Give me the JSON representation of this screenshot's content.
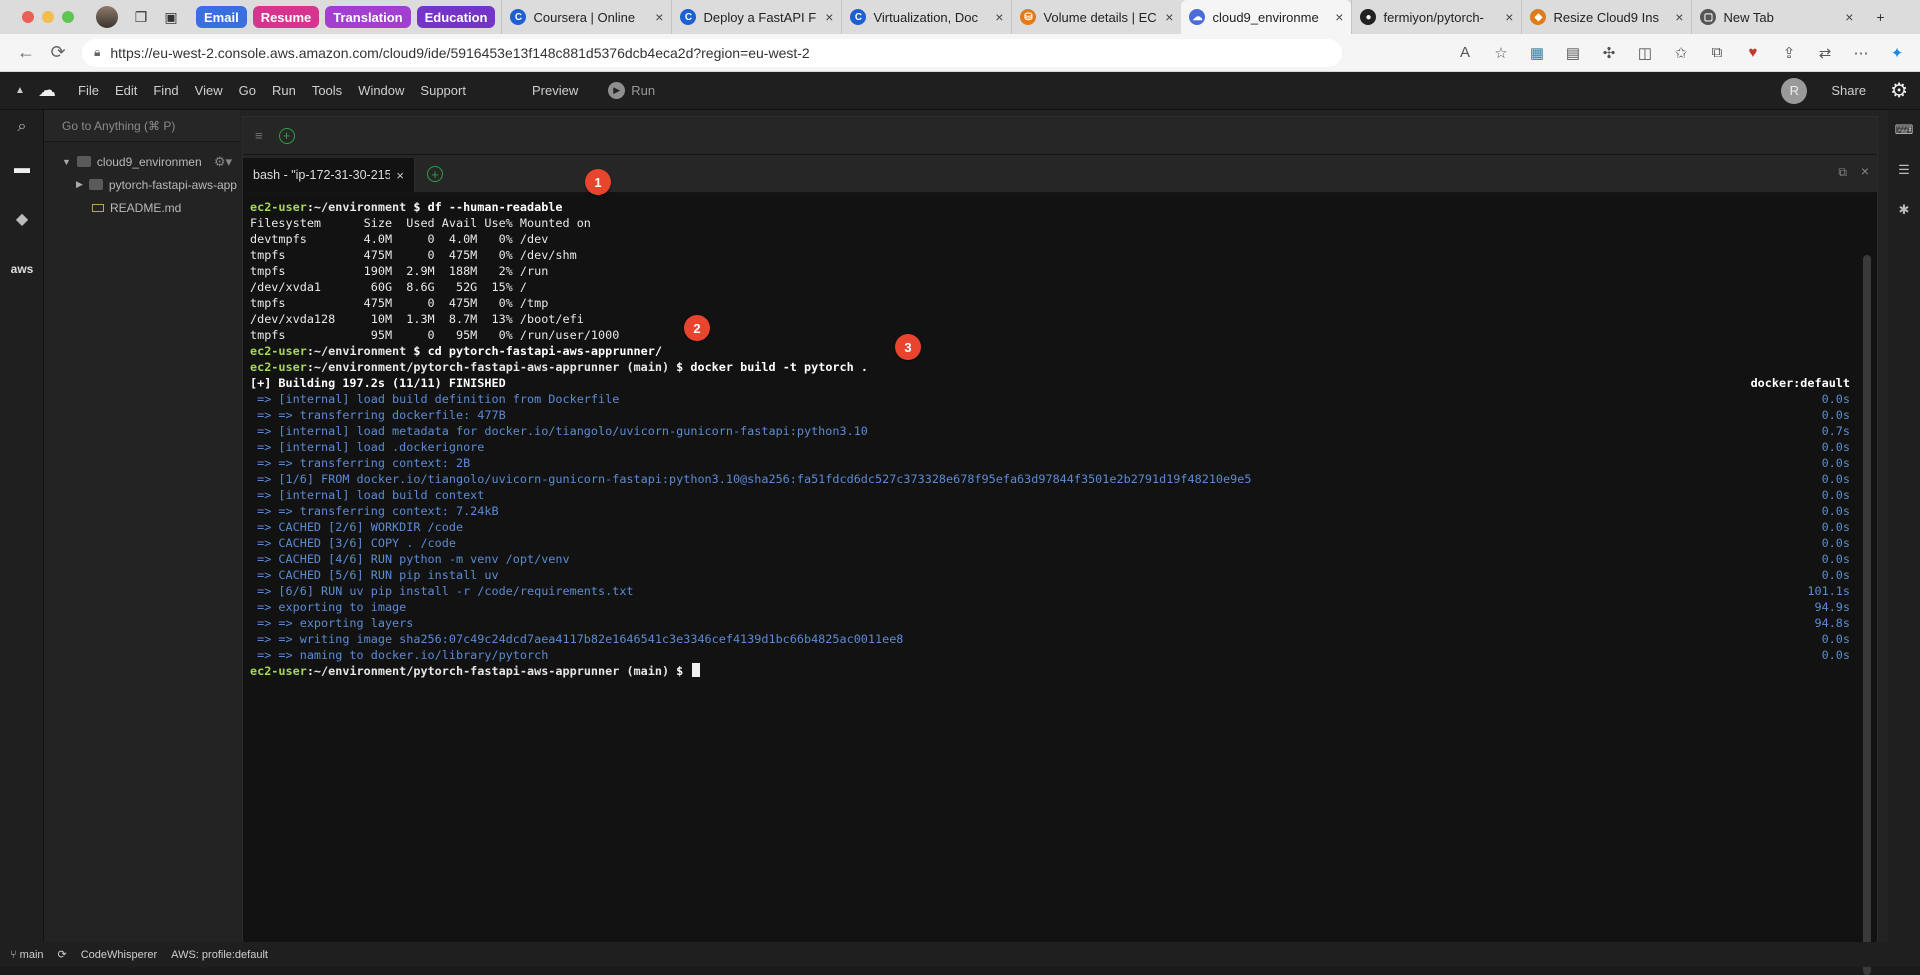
{
  "browser": {
    "tab_groups": [
      {
        "label": "Email",
        "color": "#3a6fe0"
      },
      {
        "label": "Resume",
        "color": "#d6348e"
      },
      {
        "label": "Translation",
        "color": "#a23fd0"
      },
      {
        "label": "Education",
        "color": "#7434c7"
      }
    ],
    "tabs": [
      {
        "title": "Coursera | Online",
        "fav_color": "#1f5fd6",
        "fav_glyph": "C"
      },
      {
        "title": "Deploy a FastAPI F",
        "fav_color": "#1f5fd6",
        "fav_glyph": "C"
      },
      {
        "title": "Virtualization, Doc",
        "fav_color": "#1f5fd6",
        "fav_glyph": "C"
      },
      {
        "title": "Volume details | EC",
        "fav_color": "#e07b19",
        "fav_glyph": "⛁"
      },
      {
        "title": "cloud9_environme",
        "fav_color": "#4b6bd6",
        "fav_glyph": "☁"
      },
      {
        "title": "fermiyon/pytorch-",
        "fav_color": "#222222",
        "fav_glyph": "●"
      },
      {
        "title": "Resize Cloud9 Ins",
        "fav_color": "#e07b19",
        "fav_glyph": "◆"
      },
      {
        "title": "New Tab",
        "fav_color": "#555555",
        "fav_glyph": "▢"
      }
    ],
    "url": "https://eu-west-2.console.aws.amazon.com/cloud9/ide/5916453e13f148c881d5376dcb4eca2d?region=eu-west-2"
  },
  "ide": {
    "menu": [
      "File",
      "Edit",
      "Find",
      "View",
      "Go",
      "Run",
      "Tools",
      "Window",
      "Support"
    ],
    "preview_label": "Preview",
    "run_label": "Run",
    "share_label": "Share",
    "avatar_initial": "R",
    "goto_placeholder": "Go to Anything (⌘ P)",
    "tree": {
      "root": "cloud9_environmen",
      "folder": "pytorch-fastapi-aws-app",
      "file": "README.md"
    },
    "terminal_tab": "bash - \"ip-172-31-30-215.",
    "aws_label": "aws"
  },
  "terminal": {
    "user": "ec2-user",
    "env_path": ":~/environment",
    "repo_path": ":~/environment/pytorch-fastapi-aws-apprunner",
    "branch": " (main)",
    "cmd1": " $ df --human-readable",
    "df_lines": [
      "Filesystem      Size  Used Avail Use% Mounted on",
      "devtmpfs        4.0M     0  4.0M   0% /dev",
      "tmpfs           475M     0  475M   0% /dev/shm",
      "tmpfs           190M  2.9M  188M   2% /run",
      "/dev/xvda1       60G  8.6G   52G  15% /",
      "tmpfs           475M     0  475M   0% /tmp",
      "/dev/xvda128     10M  1.3M  8.7M  13% /boot/efi",
      "tmpfs            95M     0   95M   0% /run/user/1000"
    ],
    "cmd2": " $ cd pytorch-fastapi-aws-apprunner/",
    "cmd3": " $ docker build -t pytorch .",
    "build_header": "[+] Building 197.2s (11/11) FINISHED",
    "build_context": "docker:default",
    "build_steps": [
      {
        "text": " => [internal] load build definition from Dockerfile",
        "time": "0.0s"
      },
      {
        "text": " => => transferring dockerfile: 477B",
        "time": "0.0s"
      },
      {
        "text": " => [internal] load metadata for docker.io/tiangolo/uvicorn-gunicorn-fastapi:python3.10",
        "time": "0.7s"
      },
      {
        "text": " => [internal] load .dockerignore",
        "time": "0.0s"
      },
      {
        "text": " => => transferring context: 2B",
        "time": "0.0s"
      },
      {
        "text": " => [1/6] FROM docker.io/tiangolo/uvicorn-gunicorn-fastapi:python3.10@sha256:fa51fdcd6dc527c373328e678f95efa63d97844f3501e2b2791d19f48210e9e5",
        "time": "0.0s"
      },
      {
        "text": " => [internal] load build context",
        "time": "0.0s"
      },
      {
        "text": " => => transferring context: 7.24kB",
        "time": "0.0s"
      },
      {
        "text": " => CACHED [2/6] WORKDIR /code",
        "time": "0.0s"
      },
      {
        "text": " => CACHED [3/6] COPY . /code",
        "time": "0.0s"
      },
      {
        "text": " => CACHED [4/6] RUN python -m venv /opt/venv",
        "time": "0.0s"
      },
      {
        "text": " => CACHED [5/6] RUN pip install uv",
        "time": "0.0s"
      },
      {
        "text": " => [6/6] RUN uv pip install -r /code/requirements.txt",
        "time": "101.1s"
      },
      {
        "text": " => exporting to image",
        "time": "94.9s"
      },
      {
        "text": " => => exporting layers",
        "time": "94.8s"
      },
      {
        "text": " => => writing image sha256:07c49c24dcd7aea4117b82e1646541c3e3346cef4139d1bc66b4825ac0011ee8",
        "time": "0.0s"
      },
      {
        "text": " => => naming to docker.io/library/pytorch",
        "time": "0.0s"
      }
    ],
    "prompt_tail": " $ "
  },
  "annotations": [
    "1",
    "2",
    "3"
  ],
  "status": {
    "branch": "main",
    "codewhisperer": "CodeWhisperer",
    "profile": "AWS: profile:default"
  }
}
